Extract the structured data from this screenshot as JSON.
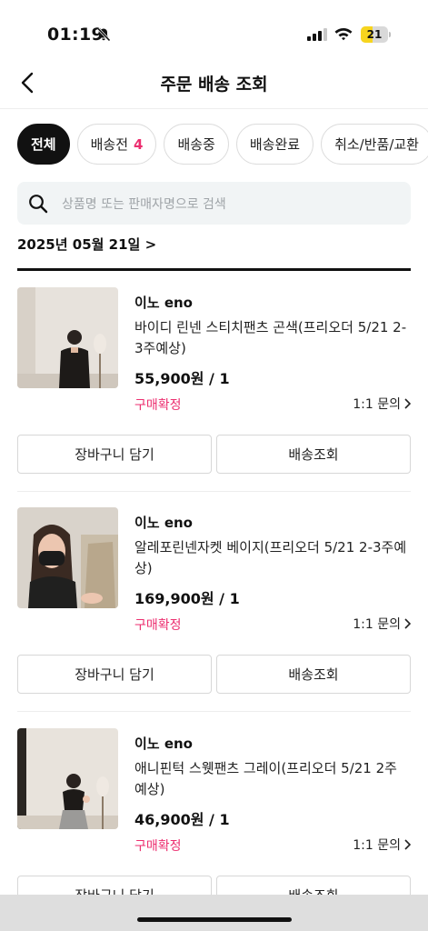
{
  "status_bar": {
    "time": "01:19",
    "battery": "21",
    "battery_level": 0.21,
    "battery_color": "#f7d51e"
  },
  "nav": {
    "title": "주문 배송 조회"
  },
  "tabs": [
    {
      "label": "전체",
      "count": "",
      "active": true
    },
    {
      "label": "배송전",
      "count": "4",
      "active": false
    },
    {
      "label": "배송중",
      "count": "",
      "active": false
    },
    {
      "label": "배송완료",
      "count": "",
      "active": false
    },
    {
      "label": "취소/반품/교환",
      "count": "",
      "active": false
    }
  ],
  "search": {
    "placeholder": "상품명 또는 판매자명으로 검색"
  },
  "date_header": "2025년 05월 21일 >",
  "orders": [
    {
      "seller": "이노 eno",
      "product": "바이디 린넨 스티치팬츠 곤색(프리오더 5/21 2-3주예상)",
      "price": "55,900원 / 1",
      "status": "구매확정",
      "inquiry": "1:1 문의",
      "cart_button": "장바구니 담기",
      "track_button": "배송조회"
    },
    {
      "seller": "이노 eno",
      "product": "알레포린넨자켓 베이지(프리오더 5/21 2-3주예상)",
      "price": "169,900원 / 1",
      "status": "구매확정",
      "inquiry": "1:1 문의",
      "cart_button": "장바구니 담기",
      "track_button": "배송조회"
    },
    {
      "seller": "이노 eno",
      "product": "애니핀턱 스웻팬츠 그레이(프리오더 5/21 2주예상)",
      "price": "46,900원 / 1",
      "status": "구매확정",
      "inquiry": "1:1 문의",
      "cart_button": "장바구니 담기",
      "track_button": "배송조회"
    }
  ],
  "colors": {
    "accent": "#ec2e6f",
    "primary": "#111111",
    "search_bg": "#f1f4f5"
  }
}
